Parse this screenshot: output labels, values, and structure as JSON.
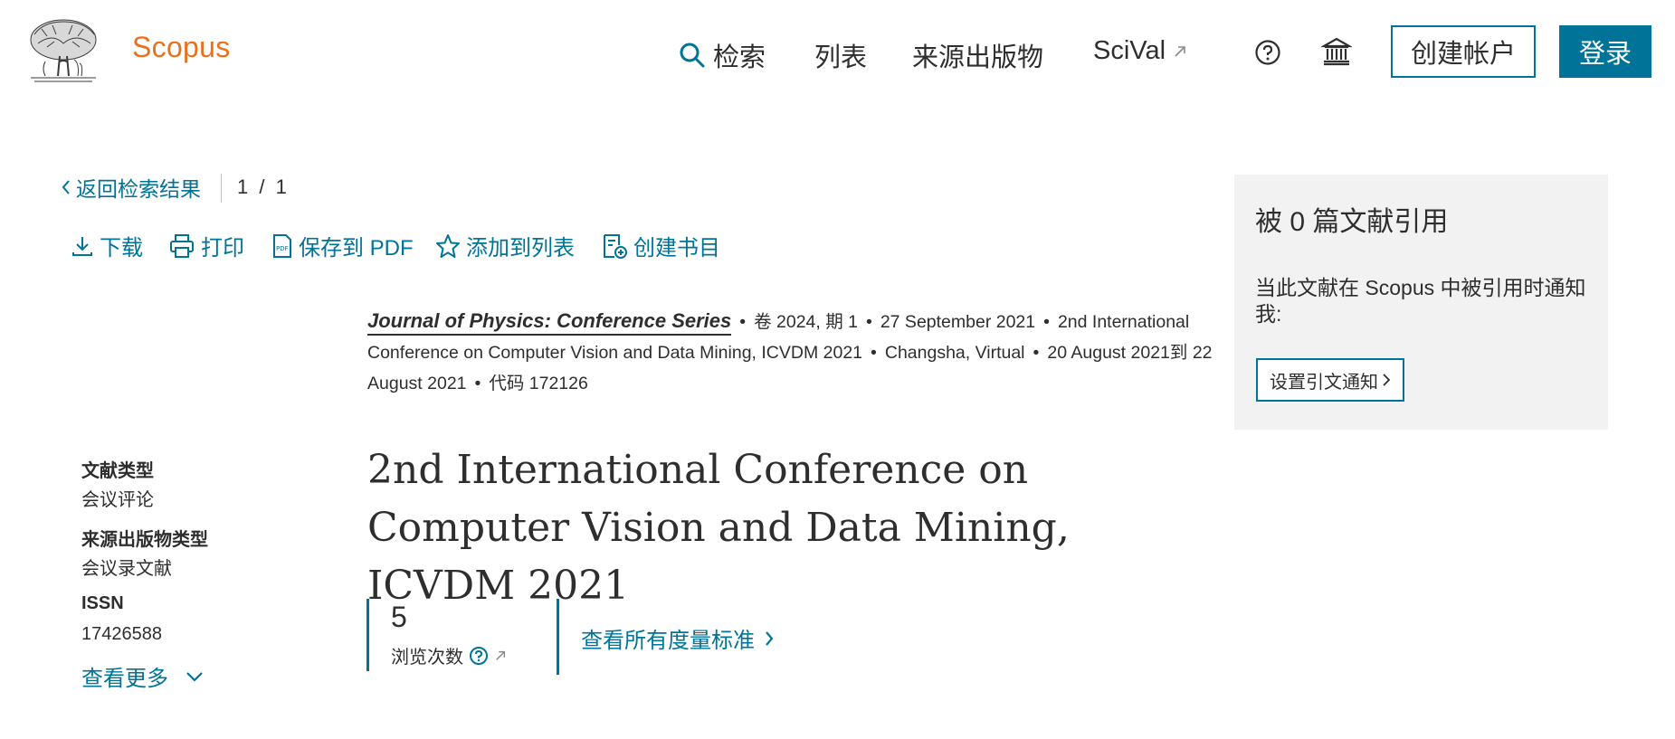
{
  "header": {
    "brand": "Scopus",
    "nav": {
      "search": "检索",
      "lists": "列表",
      "sources": "来源出版物",
      "scival": "SciVal"
    },
    "create_account": "创建帐户",
    "login": "登录"
  },
  "back": {
    "label": "返回检索结果",
    "pager": "1 / 1"
  },
  "toolbar": {
    "download": "下载",
    "print": "打印",
    "save_pdf": "保存到 PDF",
    "add_to_list": "添加到列表",
    "create_bibliography": "创建书目"
  },
  "source": {
    "journal": "Journal of Physics: Conference Series",
    "volume": "卷 2024, 期 1",
    "date": "27 September 2021",
    "conference": "2nd International Conference on Computer Vision and Data Mining, ICVDM 2021",
    "location": "Changsha, Virtual",
    "conf_dates": "20 August 2021到 22 August 2021",
    "code": "代码 172126"
  },
  "document": {
    "title": "2nd International Conference on Computer Vision and Data Mining, ICVDM 2021"
  },
  "meta": {
    "doc_type_label": "文献类型",
    "doc_type_value": "会议评论",
    "source_type_label": "来源出版物类型",
    "source_type_value": "会议录文献",
    "issn_label": "ISSN",
    "issn_value": "17426588",
    "show_more": "查看更多"
  },
  "metrics": {
    "views": "5",
    "views_label": "浏览次数",
    "all_metrics": "查看所有度量标准"
  },
  "citations": {
    "title": "被 0 篇文献引用",
    "alert_text": "当此文献在 Scopus 中被引用时通知我:",
    "alert_button": "设置引文通知"
  },
  "colors": {
    "accent": "#007398",
    "brand": "#e9711c",
    "panel_bg": "#f2f2f2",
    "text": "#2e2e2e"
  },
  "icons": [
    "elsevier-tree-logo",
    "search-icon",
    "external-link-icon",
    "help-icon",
    "institution-icon",
    "chevron-left-icon",
    "download-icon",
    "print-icon",
    "pdf-icon",
    "star-icon",
    "bibliography-icon",
    "chevron-down-icon",
    "chevron-right-icon"
  ]
}
